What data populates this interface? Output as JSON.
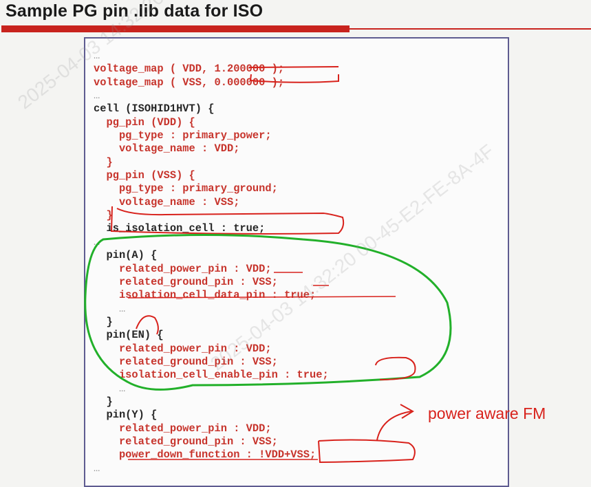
{
  "slide": {
    "title": "Sample PG pin .lib data for ISO"
  },
  "code": {
    "lines": [
      {
        "text": "…",
        "kind": "dim"
      },
      {
        "text": "voltage_map ( VDD, 1.200000 );",
        "kind": "red"
      },
      {
        "text": "voltage_map ( VSS, 0.000000 );",
        "kind": "red"
      },
      {
        "text": "…",
        "kind": "dim"
      },
      {
        "text": "cell (ISOHID1HVT) {",
        "kind": "dark"
      },
      {
        "text": "  pg_pin (VDD) {",
        "kind": "red"
      },
      {
        "text": "    pg_type : primary_power;",
        "kind": "red"
      },
      {
        "text": "    voltage_name : VDD;",
        "kind": "red"
      },
      {
        "text": "  }",
        "kind": "red"
      },
      {
        "text": "  pg_pin (VSS) {",
        "kind": "red"
      },
      {
        "text": "    pg_type : primary_ground;",
        "kind": "red"
      },
      {
        "text": "    voltage_name : VSS;",
        "kind": "red"
      },
      {
        "text": "  }",
        "kind": "red"
      },
      {
        "text": "  is_isolation_cell : true;",
        "kind": "dark"
      },
      {
        "text": "…",
        "kind": "dim"
      },
      {
        "text": "  pin(A) {",
        "kind": "dark"
      },
      {
        "text": "    related_power_pin : VDD;",
        "kind": "red"
      },
      {
        "text": "    related_ground_pin : VSS;",
        "kind": "red"
      },
      {
        "text": "    isolation_cell_data_pin : true;",
        "kind": "red"
      },
      {
        "text": "    …",
        "kind": "dim"
      },
      {
        "text": "  }",
        "kind": "dark"
      },
      {
        "text": "  pin(EN) {",
        "kind": "dark"
      },
      {
        "text": "    related_power_pin : VDD;",
        "kind": "red"
      },
      {
        "text": "    related_ground_pin : VSS;",
        "kind": "red"
      },
      {
        "text": "    isolation_cell_enable_pin : true;",
        "kind": "red"
      },
      {
        "text": "    …",
        "kind": "dim"
      },
      {
        "text": "  }",
        "kind": "dark"
      },
      {
        "text": "  pin(Y) {",
        "kind": "dark"
      },
      {
        "text": "    related_power_pin : VDD;",
        "kind": "red"
      },
      {
        "text": "    related_ground_pin : VSS;",
        "kind": "red"
      },
      {
        "text": "    power_down_function : !VDD+VSS;",
        "kind": "red"
      },
      {
        "text": "…",
        "kind": "dim"
      }
    ]
  },
  "annotation": {
    "text": "power aware FM"
  },
  "watermark": {
    "text": "2025-04-03 14:32:20  00-45-E2-FE-8A-4F"
  },
  "colors": {
    "title_bar": "#c8231e",
    "code_red": "#c7342c",
    "annotation_red": "#d8221c",
    "highlight_green": "#22b02a",
    "panel_border": "#5e5b90"
  }
}
